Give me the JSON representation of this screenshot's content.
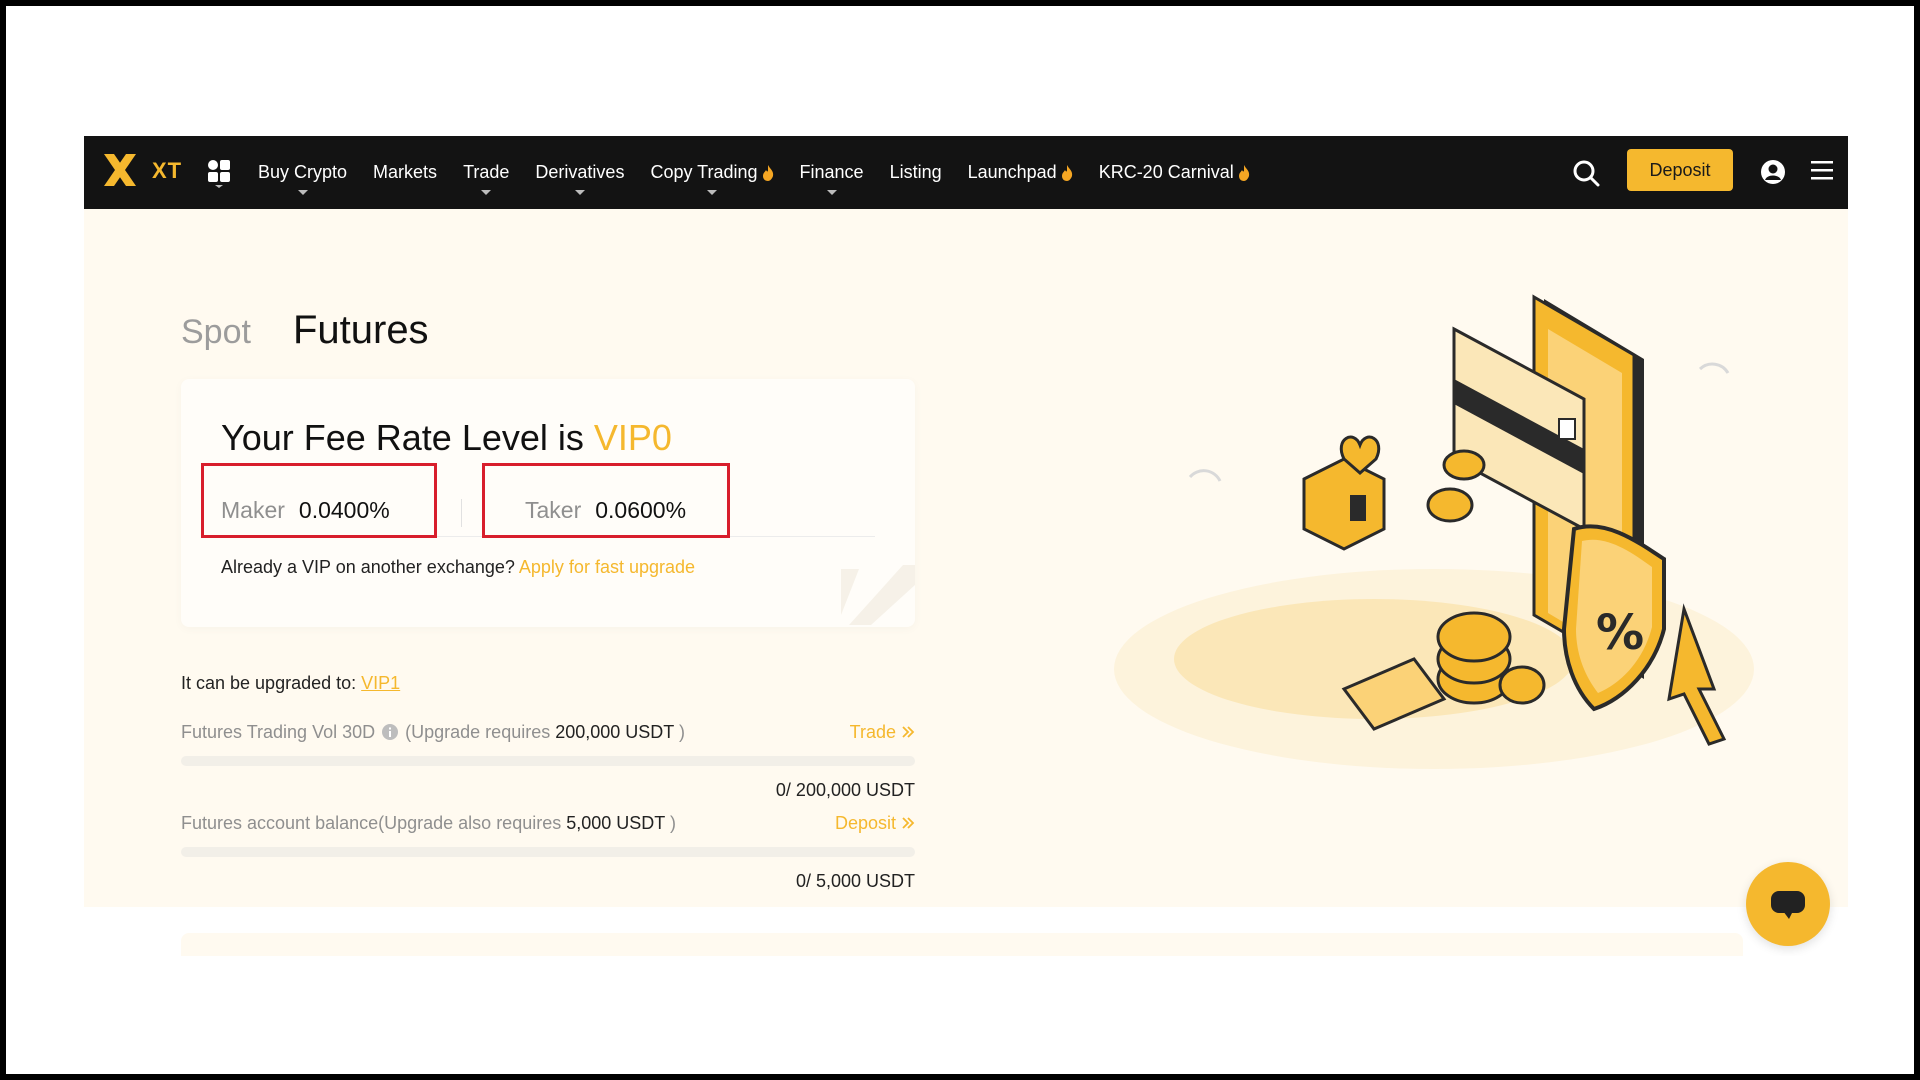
{
  "nav": {
    "logo_text": "XT",
    "items": [
      {
        "label": "Buy Crypto",
        "caret": true,
        "fire": false
      },
      {
        "label": "Markets",
        "caret": false,
        "fire": false
      },
      {
        "label": "Trade",
        "caret": true,
        "fire": false
      },
      {
        "label": "Derivatives",
        "caret": true,
        "fire": false
      },
      {
        "label": "Copy Trading",
        "caret": true,
        "fire": true
      },
      {
        "label": "Finance",
        "caret": true,
        "fire": false
      },
      {
        "label": "Listing",
        "caret": false,
        "fire": false
      },
      {
        "label": "Launchpad",
        "caret": false,
        "fire": true
      },
      {
        "label": "KRC-20 Carnival",
        "caret": false,
        "fire": true
      }
    ],
    "deposit_label": "Deposit"
  },
  "tabs": {
    "spot": "Spot",
    "futures": "Futures"
  },
  "fee": {
    "title_prefix": "Your Fee Rate Level is ",
    "level": "VIP0",
    "maker_label": "Maker",
    "maker_value": "0.0400%",
    "taker_label": "Taker",
    "taker_value": "0.0600%",
    "vip_question": "Already a VIP on another exchange?",
    "vip_link": "Apply for fast upgrade"
  },
  "upgrade": {
    "prefix": "It can be upgraded to:",
    "target": "VIP1"
  },
  "requirements": [
    {
      "label": "Futures Trading Vol 30D",
      "note_prefix": "(Upgrade requires ",
      "note_amount": "200,000 USDT",
      "note_suffix": ")",
      "action": "Trade",
      "progress_value": "0/ 200,000 USDT",
      "progress_fraction": 0
    },
    {
      "label": "Futures account balance",
      "note_prefix": "(Upgrade also requires ",
      "note_amount": "5,000 USDT",
      "note_suffix": ")",
      "action": "Deposit",
      "progress_value": "0/ 5,000 USDT",
      "progress_fraction": 0
    }
  ],
  "colors": {
    "accent": "#f5b82e",
    "nav_bg": "#131313",
    "hero_bg": "#fffaf0",
    "highlight": "#d81e2c"
  }
}
